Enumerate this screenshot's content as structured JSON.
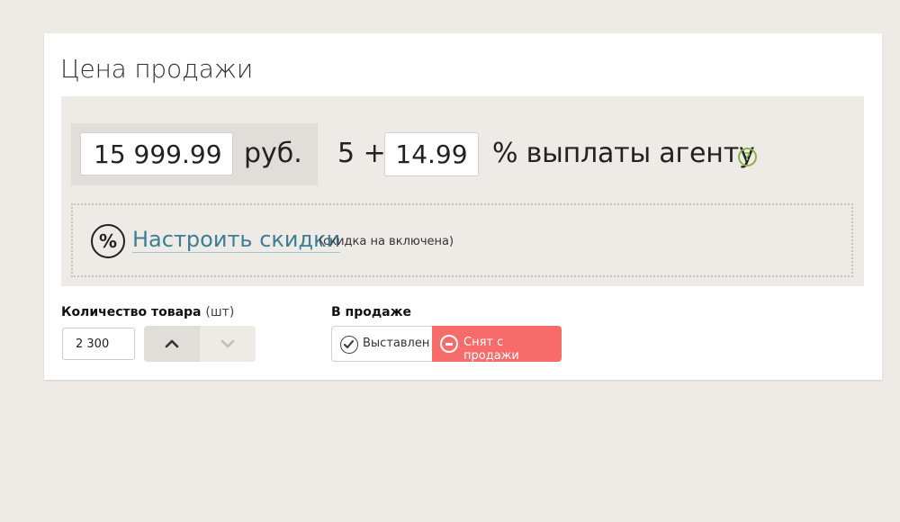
{
  "title": "Цена продажи",
  "price": {
    "value": "15 999.99",
    "currency": "руб."
  },
  "agent_fee": {
    "base": "5 +",
    "value": "14.99",
    "label": "% выплаты агенту",
    "help_glyph": "?"
  },
  "discount": {
    "icon_glyph": "%",
    "link": "Настроить скидки",
    "note": "(скидка на включена)"
  },
  "quantity": {
    "label": "Количество товара",
    "unit": "(шт)",
    "value": "2 300"
  },
  "sale_status": {
    "label": "В продаже",
    "on_label": "Выставлен",
    "off_label": "Снят с продажи",
    "selected": "off"
  },
  "colors": {
    "accent_link": "#3a7f96",
    "danger": "#f76b6b",
    "help": "#8bb24a",
    "background": "#eeebe6"
  },
  "icons": [
    "help-icon",
    "percent-icon",
    "chevron-up-icon",
    "chevron-down-icon",
    "check-circle-icon",
    "minus-circle-icon"
  ]
}
